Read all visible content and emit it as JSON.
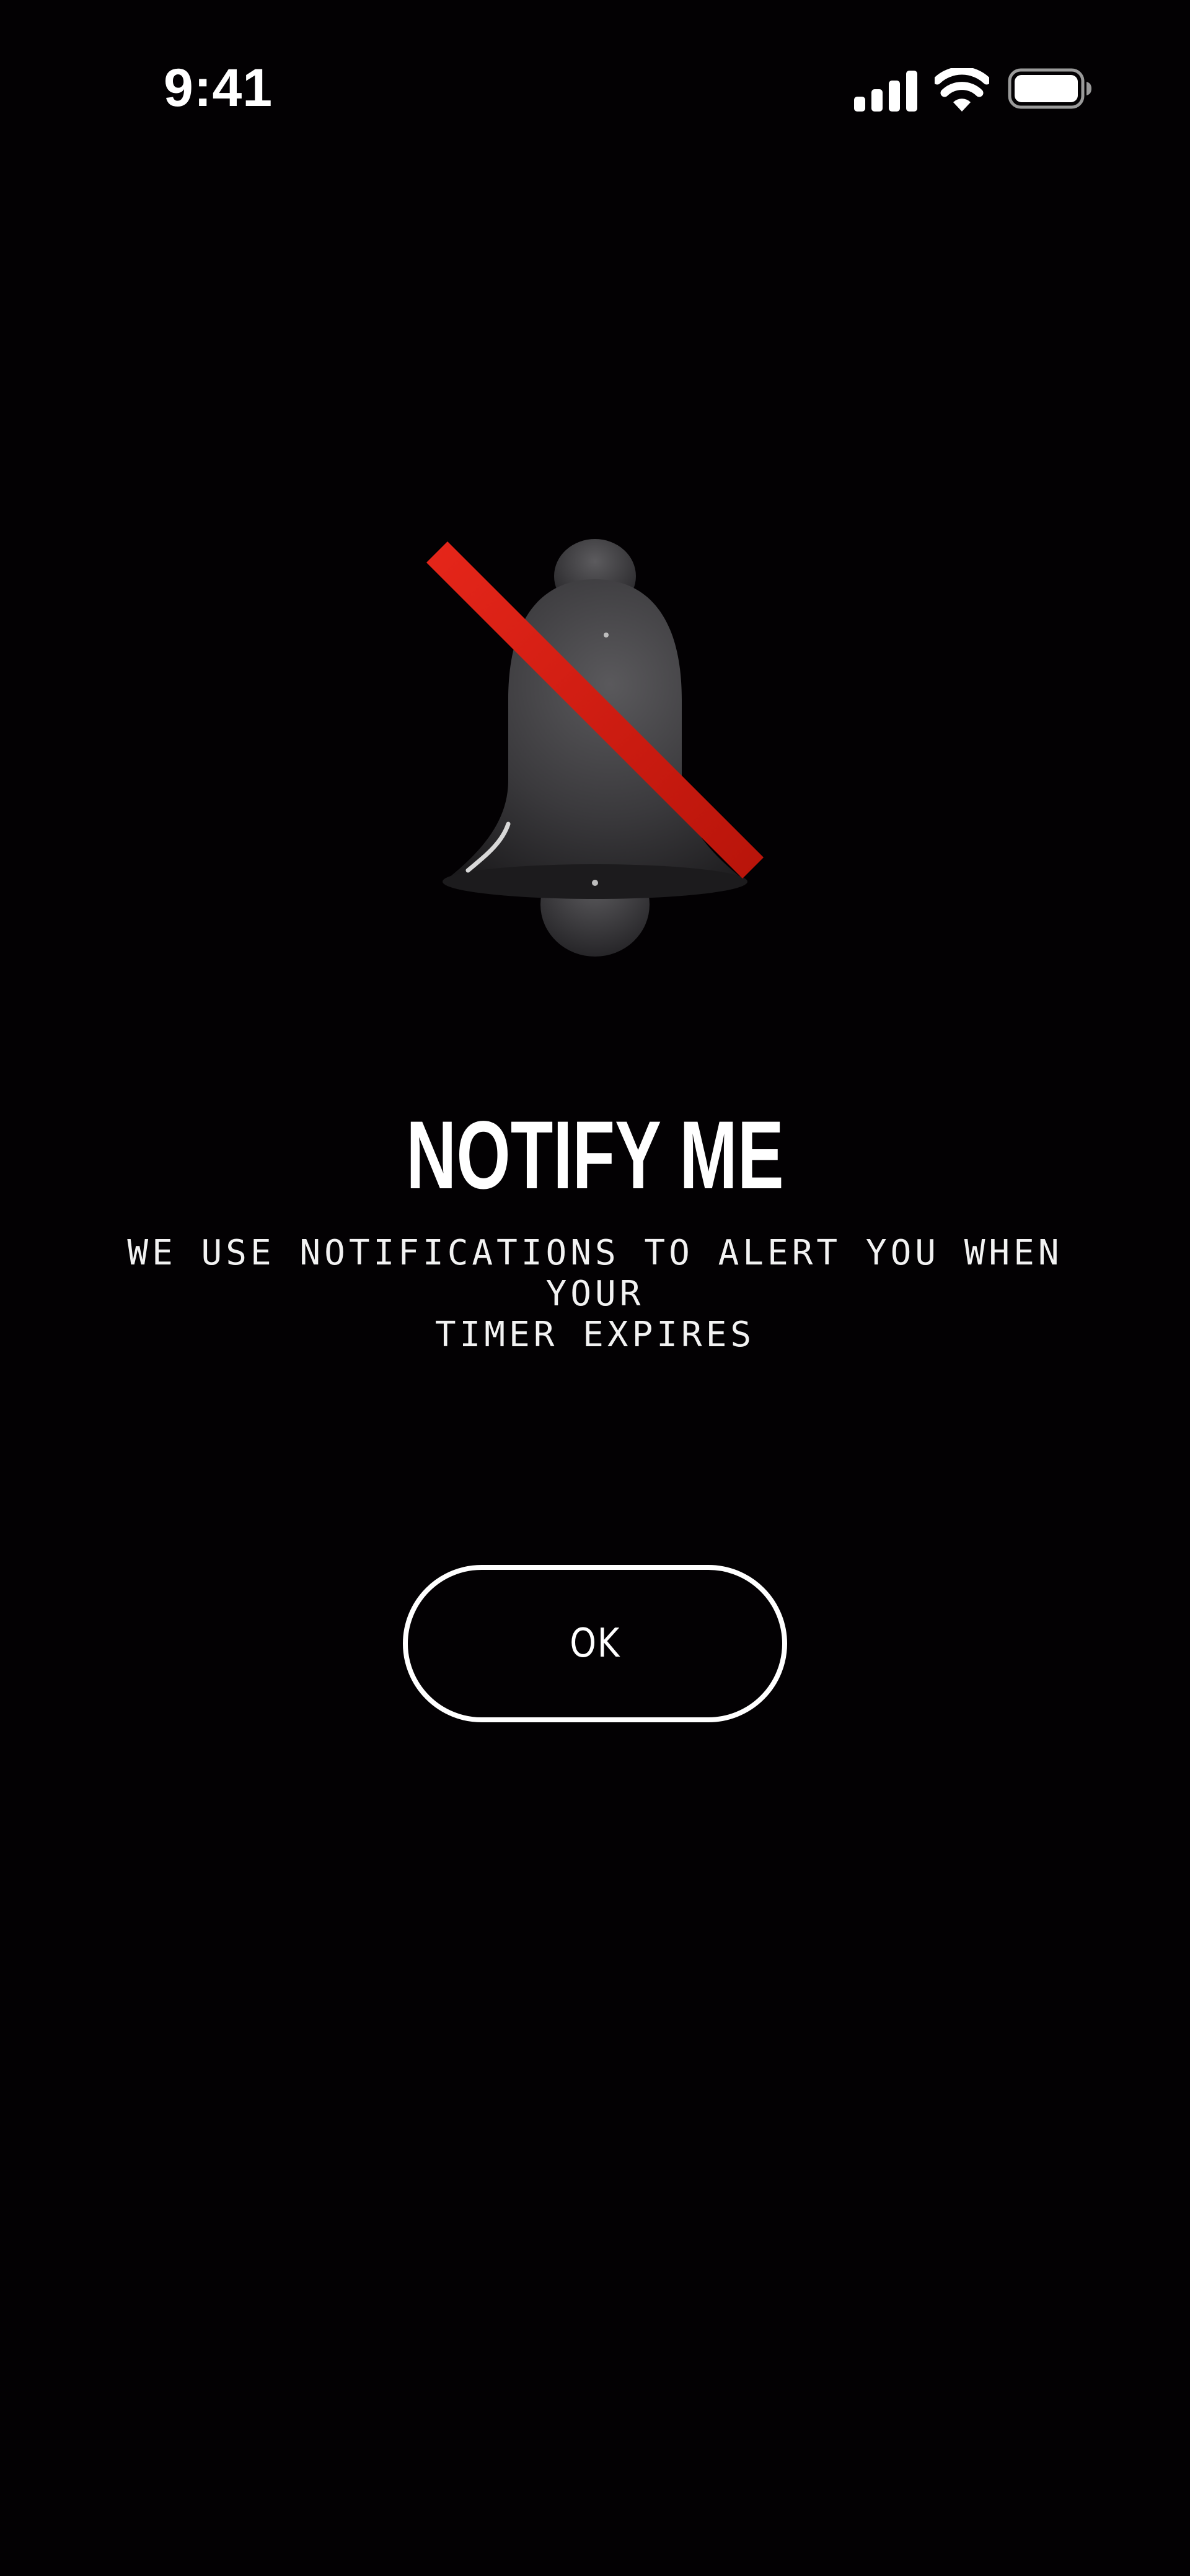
{
  "status_bar": {
    "time": "9:41",
    "icons": [
      "cellular-signal-icon",
      "wifi-icon",
      "battery-icon"
    ]
  },
  "hero": {
    "icon": "notification-bell-disabled-icon",
    "slash_color": "#d61a0e",
    "bell_color": "#3a393c"
  },
  "content": {
    "title": "NOTIFY ME",
    "subtitle_line1": "WE USE NOTIFICATIONS TO ALERT YOU WHEN YOUR",
    "subtitle_line2": "TIMER EXPIRES"
  },
  "actions": {
    "ok_label": "OK"
  },
  "colors": {
    "background": "#030103",
    "text": "#ffffff"
  }
}
